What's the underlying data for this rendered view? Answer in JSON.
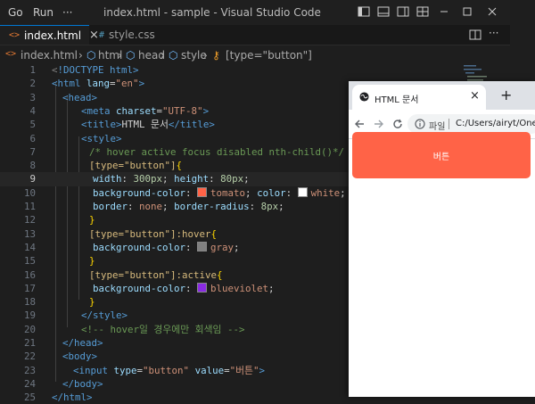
{
  "vscode": {
    "menu": [
      "Go",
      "Run",
      "···"
    ],
    "window_title": "index.html - sample - Visual Studio Code",
    "tabs": [
      {
        "icon": "<>",
        "label": "index.html",
        "active": true,
        "close": "×"
      },
      {
        "icon": "#",
        "label": "style.css",
        "active": false
      }
    ],
    "breadcrumb": [
      "index.html",
      "html",
      "head",
      "style",
      "[type=\"button\"]"
    ],
    "current_line": 9,
    "colors": {
      "accent": "#0078d4",
      "tomato": "#ff6347",
      "white": "#ffffff",
      "gray": "#808080",
      "blueviolet": "#8a2be2"
    }
  },
  "code_lines": [
    {
      "n": "1"
    },
    {
      "n": "2"
    },
    {
      "n": "3"
    },
    {
      "n": "4"
    },
    {
      "n": "5"
    },
    {
      "n": "6"
    },
    {
      "n": "7"
    },
    {
      "n": "8"
    },
    {
      "n": "9"
    },
    {
      "n": "10"
    },
    {
      "n": "11"
    },
    {
      "n": "12"
    },
    {
      "n": "13"
    },
    {
      "n": "14"
    },
    {
      "n": "15"
    },
    {
      "n": "16"
    },
    {
      "n": "17"
    },
    {
      "n": "18"
    },
    {
      "n": "19"
    },
    {
      "n": "20"
    },
    {
      "n": "21"
    },
    {
      "n": "22"
    },
    {
      "n": "23"
    },
    {
      "n": "24"
    },
    {
      "n": "25"
    }
  ],
  "code": {
    "l1": "<!DOCTYPE html>",
    "l2_open": "<html ",
    "l2_attr": "lang",
    "l2_val": "\"en\"",
    "l2_close": ">",
    "l3": "<head>",
    "l4_open": "<meta ",
    "l4_attr": "charset",
    "l4_val": "\"UTF-8\"",
    "l4_close": ">",
    "l5_open": "<title>",
    "l5_text": "HTML 문서",
    "l5_close": "</title>",
    "l6": "<style>",
    "l7": "/* hover active focus disabled nth-child()*/",
    "l8_sel": "[type=\"button\"]",
    "l8_brace": "{",
    "l9_p1": "width",
    "l9_v1": "300px",
    "l9_p2": "height",
    "l9_v2": "80px",
    "l10_p1": "background-color",
    "l10_v1": "tomato",
    "l10_p2": "color",
    "l10_v2": "white",
    "l11_p1": "border",
    "l11_v1": "none",
    "l11_p2": "border-radius",
    "l11_v2": "8px",
    "l12": "}",
    "l13_sel": "[type=\"button\"]:hover",
    "l13_brace": "{",
    "l14_p": "background-color",
    "l14_v": "gray",
    "l15": "}",
    "l16_sel": "[type=\"button\"]:active",
    "l16_brace": "{",
    "l17_p": "background-color",
    "l17_v": "blueviolet",
    "l18": "}",
    "l19": "</style>",
    "l20": "<!-- hover일 경우에만 회색임 -->",
    "l21": "</head>",
    "l22": "<body>",
    "l23_open": "<input ",
    "l23_a1": "type",
    "l23_v1": "\"button\"",
    "l23_a2": "value",
    "l23_v2": "\"버튼\"",
    "l23_close": ">",
    "l24": "</body>",
    "l25": "</html>"
  },
  "browser": {
    "tab_title": "HTML 문서",
    "tab_close": "×",
    "new_tab": "+",
    "address_label": "파일",
    "address_url": "C:/Users/airyt/OneDr",
    "page_button_label": "버튼",
    "page_button_color": "#ff6347"
  }
}
